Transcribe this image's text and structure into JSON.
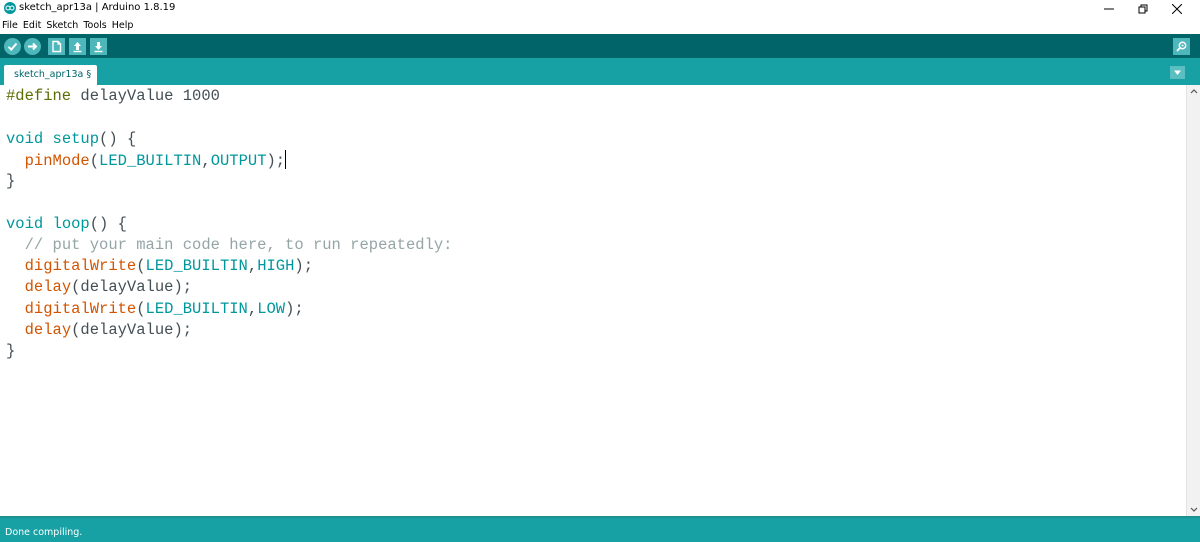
{
  "window": {
    "title": "sketch_apr13a | Arduino 1.8.19"
  },
  "menu": [
    "File",
    "Edit",
    "Sketch",
    "Tools",
    "Help"
  ],
  "toolbar": {
    "buttons": [
      "verify-icon",
      "upload-icon",
      "new-icon",
      "open-icon",
      "save-icon"
    ],
    "right_button": "serial-monitor-icon"
  },
  "tabs": [
    {
      "label": "sketch_apr13a §"
    }
  ],
  "editor": {
    "lines": [
      [
        {
          "t": "pre",
          "v": "#define"
        },
        {
          "t": "plain",
          "v": " delayValue 1000"
        }
      ],
      [],
      [
        {
          "t": "kw",
          "v": "void"
        },
        {
          "t": "plain",
          "v": " "
        },
        {
          "t": "kw",
          "v": "setup"
        },
        {
          "t": "plain",
          "v": "() {"
        }
      ],
      [
        {
          "t": "plain",
          "v": "  "
        },
        {
          "t": "fn",
          "v": "pinMode"
        },
        {
          "t": "plain",
          "v": "("
        },
        {
          "t": "const",
          "v": "LED_BUILTIN"
        },
        {
          "t": "plain",
          "v": ","
        },
        {
          "t": "const",
          "v": "OUTPUT"
        },
        {
          "t": "plain",
          "v": ");"
        },
        {
          "t": "caret",
          "v": ""
        }
      ],
      [
        {
          "t": "plain",
          "v": "}"
        }
      ],
      [],
      [
        {
          "t": "kw",
          "v": "void"
        },
        {
          "t": "plain",
          "v": " "
        },
        {
          "t": "kw",
          "v": "loop"
        },
        {
          "t": "plain",
          "v": "() {"
        }
      ],
      [
        {
          "t": "plain",
          "v": "  "
        },
        {
          "t": "comment",
          "v": "// put your main code here, to run repeatedly:"
        }
      ],
      [
        {
          "t": "plain",
          "v": "  "
        },
        {
          "t": "fn",
          "v": "digitalWrite"
        },
        {
          "t": "plain",
          "v": "("
        },
        {
          "t": "const",
          "v": "LED_BUILTIN"
        },
        {
          "t": "plain",
          "v": ","
        },
        {
          "t": "const",
          "v": "HIGH"
        },
        {
          "t": "plain",
          "v": ");"
        }
      ],
      [
        {
          "t": "plain",
          "v": "  "
        },
        {
          "t": "fn",
          "v": "delay"
        },
        {
          "t": "plain",
          "v": "(delayValue);"
        }
      ],
      [
        {
          "t": "plain",
          "v": "  "
        },
        {
          "t": "fn",
          "v": "digitalWrite"
        },
        {
          "t": "plain",
          "v": "("
        },
        {
          "t": "const",
          "v": "LED_BUILTIN"
        },
        {
          "t": "plain",
          "v": ","
        },
        {
          "t": "const",
          "v": "LOW"
        },
        {
          "t": "plain",
          "v": ");"
        }
      ],
      [
        {
          "t": "plain",
          "v": "  "
        },
        {
          "t": "fn",
          "v": "delay"
        },
        {
          "t": "plain",
          "v": "(delayValue);"
        }
      ],
      [
        {
          "t": "plain",
          "v": "}"
        }
      ]
    ]
  },
  "status": {
    "message": "Done compiling."
  },
  "colors": {
    "toolbar": "#006468",
    "tabstrip": "#17a1a5",
    "keyword": "#00979c",
    "function": "#d35400",
    "preprocessor": "#5e6d03",
    "comment": "#95a5a6"
  }
}
